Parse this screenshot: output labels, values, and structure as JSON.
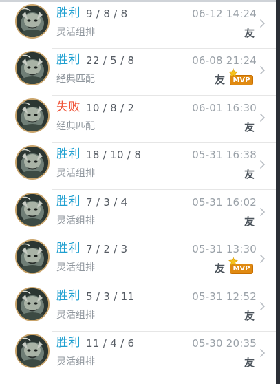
{
  "matches": [
    {
      "result": "胜利",
      "outcome": "win",
      "kda": "9 / 8 / 8",
      "time": "06-12 14:24",
      "mode": "灵活组排",
      "badge": "友",
      "mvp": false
    },
    {
      "result": "胜利",
      "outcome": "win",
      "kda": "22 / 5 / 8",
      "time": "06-08 21:24",
      "mode": "经典匹配",
      "badge": "友",
      "mvp": true
    },
    {
      "result": "失败",
      "outcome": "lose",
      "kda": "10 / 8 / 2",
      "time": "06-01 16:30",
      "mode": "经典匹配",
      "badge": "友",
      "mvp": false
    },
    {
      "result": "胜利",
      "outcome": "win",
      "kda": "18 / 10 / 8",
      "time": "05-31 16:38",
      "mode": "灵活组排",
      "badge": "友",
      "mvp": false
    },
    {
      "result": "胜利",
      "outcome": "win",
      "kda": "7 / 3 / 4",
      "time": "05-31 16:02",
      "mode": "灵活组排",
      "badge": "友",
      "mvp": false
    },
    {
      "result": "胜利",
      "outcome": "win",
      "kda": "7 / 2 / 3",
      "time": "05-31 13:30",
      "mode": "灵活组排",
      "badge": "友",
      "mvp": true
    },
    {
      "result": "胜利",
      "outcome": "win",
      "kda": "5 / 3 / 11",
      "time": "05-31 12:52",
      "mode": "灵活组排",
      "badge": "友",
      "mvp": false
    },
    {
      "result": "胜利",
      "outcome": "win",
      "kda": "11 / 4 / 6",
      "time": "05-30 20:35",
      "mode": "灵活组排",
      "badge": "友",
      "mvp": false
    }
  ],
  "mvp_label": "MVP",
  "colors": {
    "win": "#1e9fd0",
    "lose": "#f0553a",
    "mvp": "#e08a12"
  },
  "icons": {
    "avatar": "champion-portrait",
    "chevron": "chevron-right-icon",
    "mvp": "mvp-star-icon"
  }
}
